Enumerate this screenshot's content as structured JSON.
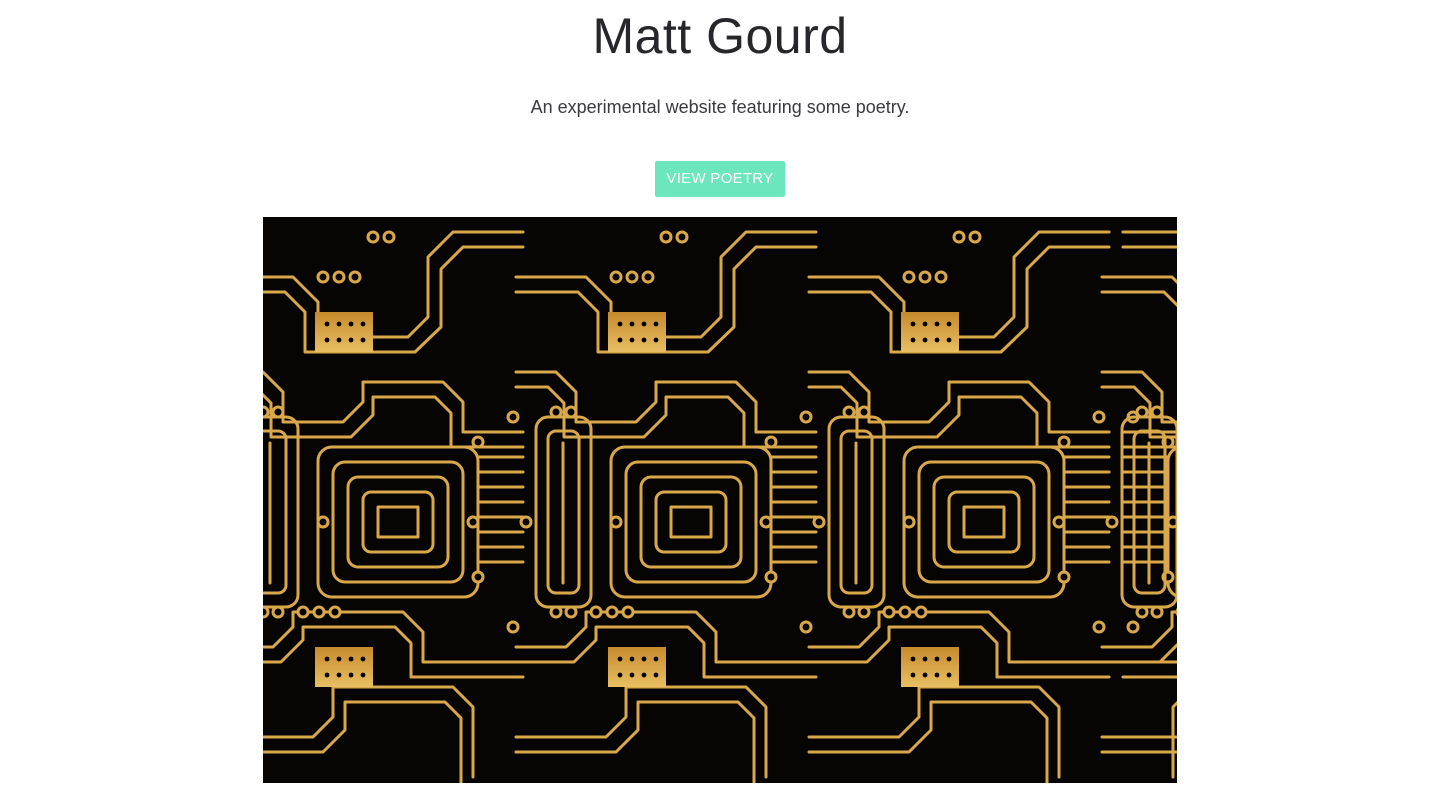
{
  "header": {
    "title": "Matt Gourd",
    "tagline": "An experimental website featuring some poetry."
  },
  "cta": {
    "label": "VIEW POETRY",
    "color": "#6ce6bc"
  },
  "hero": {
    "icon": "circuit-board-image",
    "background": "#070504",
    "trace_color": "#d9a84a",
    "pad_color": "#e2b252"
  }
}
